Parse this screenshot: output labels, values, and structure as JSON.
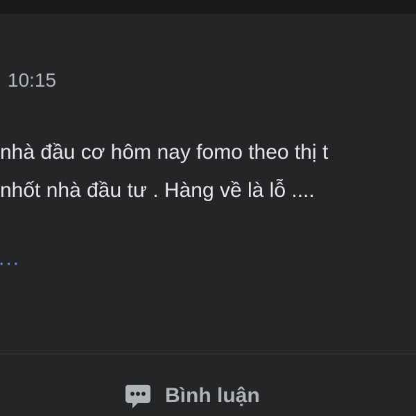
{
  "post": {
    "time": "10:15",
    "lines": [
      "nhà đầu cơ hôm nay fomo theo thị t",
      "nhốt nhà đầu tư . Hàng về là lỗ ...."
    ],
    "see_more": "..."
  },
  "actions": {
    "comment_label": "Bình luận",
    "comment_icon": "comment-bubble-icon"
  },
  "colors": {
    "background": "#18191a",
    "card": "#242526",
    "text": "#e4e6eb",
    "secondary_text": "#b0b3b8",
    "link": "#4599ff"
  }
}
